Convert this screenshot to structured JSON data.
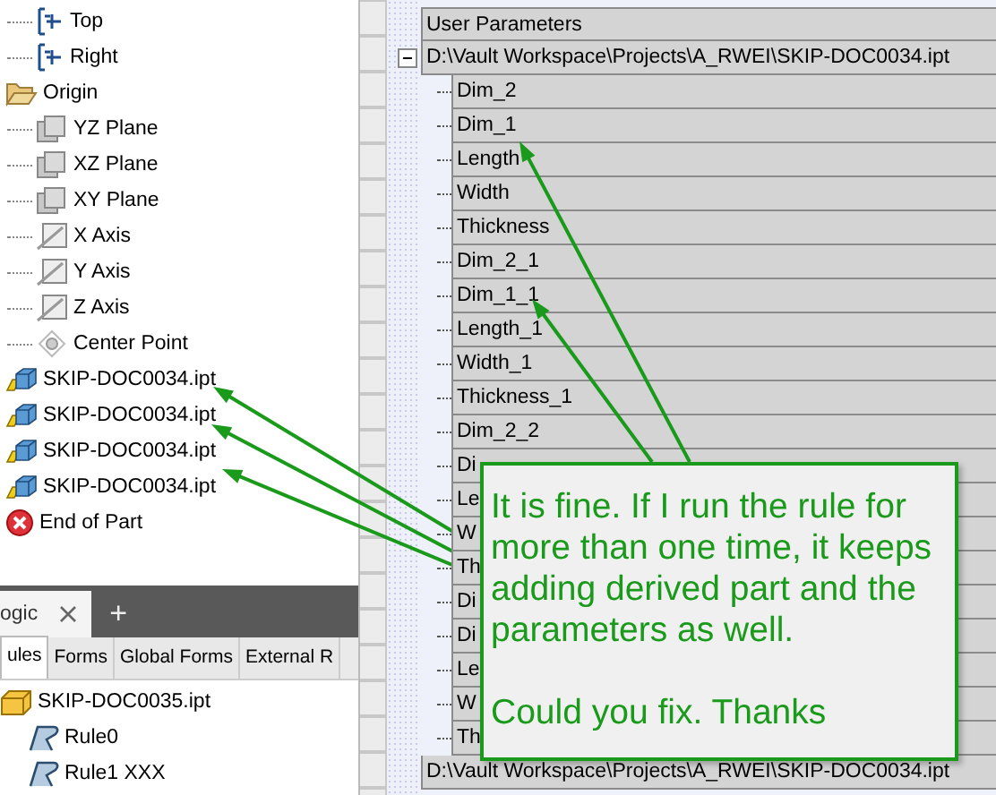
{
  "model_tree": {
    "continued_children": [
      {
        "label": "Top",
        "kind": "workplane"
      },
      {
        "label": "Right",
        "kind": "workplane"
      }
    ],
    "items": [
      {
        "label": "Origin",
        "kind": "folder",
        "expanded": true,
        "children": [
          {
            "label": "YZ Plane",
            "kind": "plane"
          },
          {
            "label": "XZ Plane",
            "kind": "plane"
          },
          {
            "label": "XY Plane",
            "kind": "plane"
          },
          {
            "label": "X Axis",
            "kind": "axis"
          },
          {
            "label": "Y Axis",
            "kind": "axis"
          },
          {
            "label": "Z Axis",
            "kind": "axis"
          },
          {
            "label": "Center Point",
            "kind": "point"
          }
        ]
      },
      {
        "label": "SKIP-DOC0034.ipt",
        "kind": "part"
      },
      {
        "label": "SKIP-DOC0034.ipt",
        "kind": "part"
      },
      {
        "label": "SKIP-DOC0034.ipt",
        "kind": "part"
      },
      {
        "label": "SKIP-DOC0034.ipt",
        "kind": "part"
      },
      {
        "label": "End of Part",
        "kind": "end"
      }
    ]
  },
  "ilogic_panel": {
    "tabs": [
      {
        "label": "ogic",
        "selected": true
      }
    ],
    "add_tab": "+",
    "subtabs": [
      {
        "label": "ules",
        "selected": true
      },
      {
        "label": "Forms",
        "selected": false
      },
      {
        "label": "Global Forms",
        "selected": false
      },
      {
        "label": "External R",
        "selected": false
      }
    ],
    "tree": [
      {
        "label": "SKIP-DOC0035.ipt",
        "kind": "part",
        "children": [
          {
            "label": "Rule0",
            "kind": "rule"
          },
          {
            "label": "Rule1 XXX",
            "kind": "rule"
          }
        ]
      }
    ]
  },
  "parameters": {
    "header": "User Parameters",
    "groups": [
      {
        "path": "D:\\Vault Workspace\\Projects\\A_RWEI\\SKIP-DOC0034.ipt",
        "expanded": true,
        "rows": [
          "Dim_2",
          "Dim_1",
          "Length",
          "Width",
          "Thickness",
          "Dim_2_1",
          "Dim_1_1",
          "Length_1",
          "Width_1",
          "Thickness_1",
          "Dim_2_2",
          "Di",
          "Le",
          "W",
          "Th",
          "Di",
          "Di",
          "Le",
          "W",
          "Th"
        ]
      },
      {
        "path": "D:\\Vault Workspace\\Projects\\A_RWEI\\SKIP-DOC0034.ipt"
      }
    ]
  },
  "callout": {
    "paragraphs": [
      "It is fine. If I run the rule for more than one time, it keeps adding derived part and the parameters as well.",
      "Could you fix. Thanks"
    ]
  }
}
